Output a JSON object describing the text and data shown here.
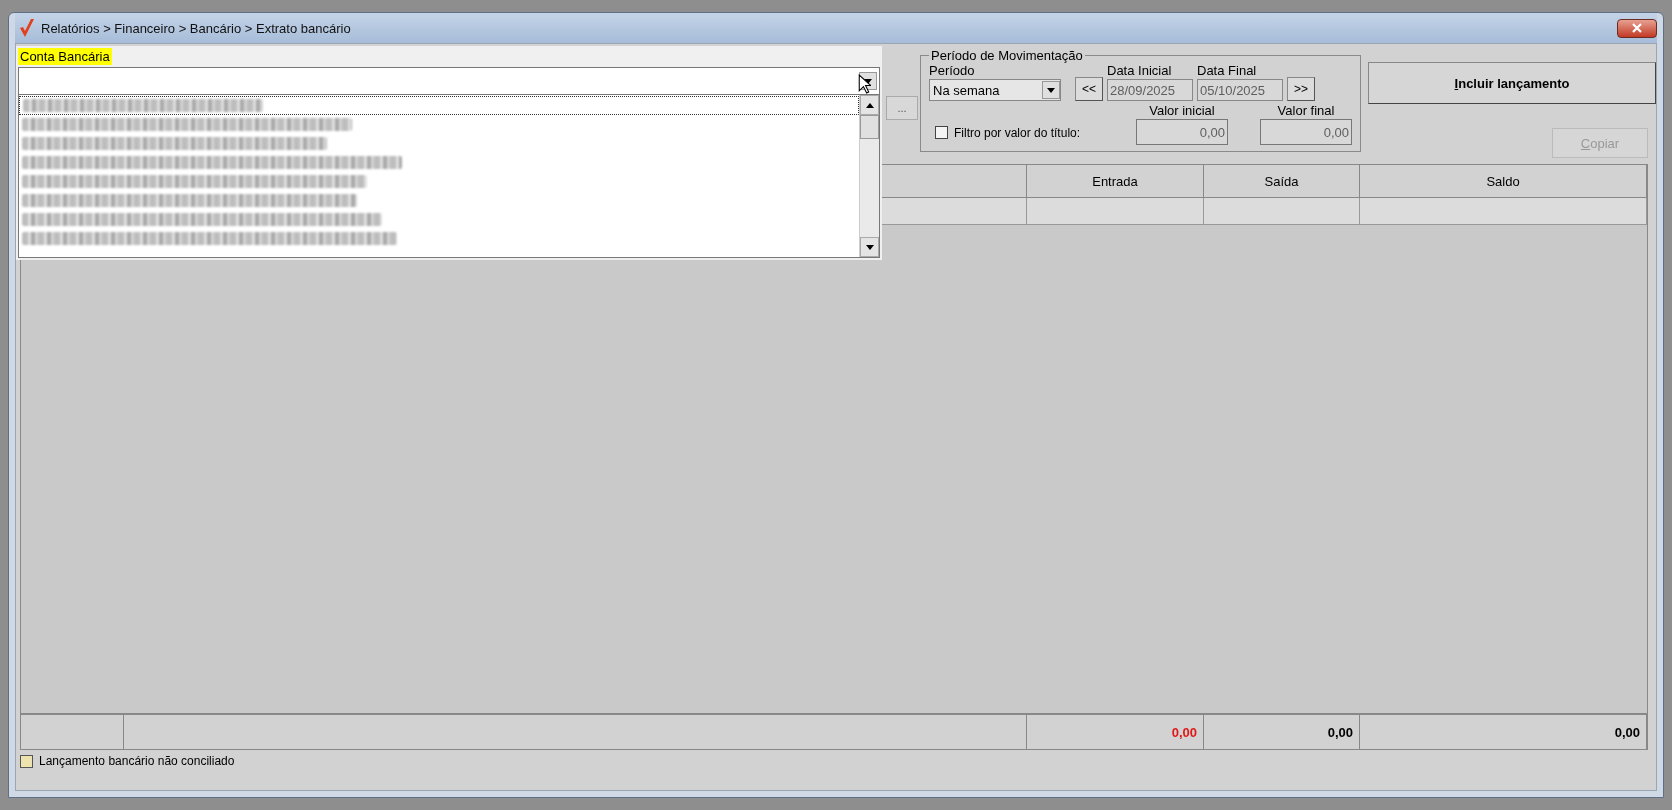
{
  "window": {
    "title": "Relatórios > Financeiro > Bancário > Extrato bancário"
  },
  "account_select": {
    "label": "Conta Bancária",
    "options": [
      {
        "kind": "obscured",
        "selected": true
      },
      {
        "kind": "obscured",
        "selected": false
      },
      {
        "kind": "obscured",
        "selected": false
      },
      {
        "kind": "obscured",
        "selected": false
      },
      {
        "kind": "obscured",
        "selected": false
      },
      {
        "kind": "obscured",
        "selected": false
      },
      {
        "kind": "obscured",
        "selected": false
      },
      {
        "kind": "obscured",
        "selected": false
      }
    ]
  },
  "browse_button": "...",
  "period_group": {
    "title": "Período de Movimentação",
    "period": {
      "label": "Período",
      "value": "Na semana"
    },
    "prev_button": "<<",
    "next_button": ">>",
    "start_date": {
      "label": "Data Inicial",
      "value": "28/09/2025",
      "disabled": true
    },
    "end_date": {
      "label": "Data Final",
      "value": "05/10/2025",
      "disabled": true
    },
    "value_filter": {
      "label": "Filtro por valor do título:",
      "checked": false
    },
    "min_value": {
      "label": "Valor inicial",
      "value": "0,00",
      "disabled": true
    },
    "max_value": {
      "label": "Valor final",
      "value": "0,00",
      "disabled": true
    }
  },
  "buttons": [
    {
      "label": "Incluir lançamento",
      "disabled": false
    },
    {
      "label": "Copiar",
      "disabled": true
    }
  ],
  "table": {
    "columns": [
      {
        "label": "Entrada"
      },
      {
        "label": "Saída"
      },
      {
        "label": "Saldo"
      }
    ],
    "totals": [
      {
        "value": "0,00",
        "negative": true
      },
      {
        "value": "0,00",
        "negative": false
      },
      {
        "value": "0,00",
        "negative": false
      }
    ]
  },
  "legend": [
    {
      "label": "Lançamento bancário não conciliado",
      "color": "#ece3ae"
    }
  ]
}
